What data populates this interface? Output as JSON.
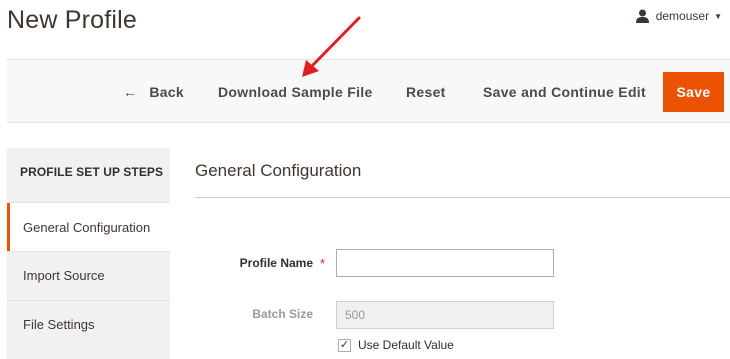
{
  "header": {
    "title": "New Profile",
    "user": {
      "name": "demouser",
      "icon": "user-icon",
      "caret_icon": "caret-down-icon"
    }
  },
  "toolbar": {
    "back_label": "Back",
    "back_icon": "left-arrow-icon",
    "download_label": "Download Sample File",
    "reset_label": "Reset",
    "save_continue_label": "Save and Continue Edit",
    "save_label": "Save",
    "save_color": "#eb5202"
  },
  "annotation": {
    "type": "red-arrow",
    "color": "#e02020"
  },
  "steps": {
    "heading": "PROFILE SET UP STEPS",
    "items": [
      {
        "label": "General Configuration",
        "active": true
      },
      {
        "label": "Import Source",
        "active": false
      },
      {
        "label": "File Settings",
        "active": false
      }
    ],
    "active_color": "#eb5202"
  },
  "section": {
    "title": "General Configuration",
    "fields": {
      "profile_name": {
        "label": "Profile Name",
        "required_mark": "*",
        "value": ""
      },
      "batch_size": {
        "label": "Batch Size",
        "value": "500",
        "disabled": true
      },
      "use_default": {
        "label": "Use Default Value",
        "checked": true,
        "check_mark": "✓"
      }
    }
  }
}
